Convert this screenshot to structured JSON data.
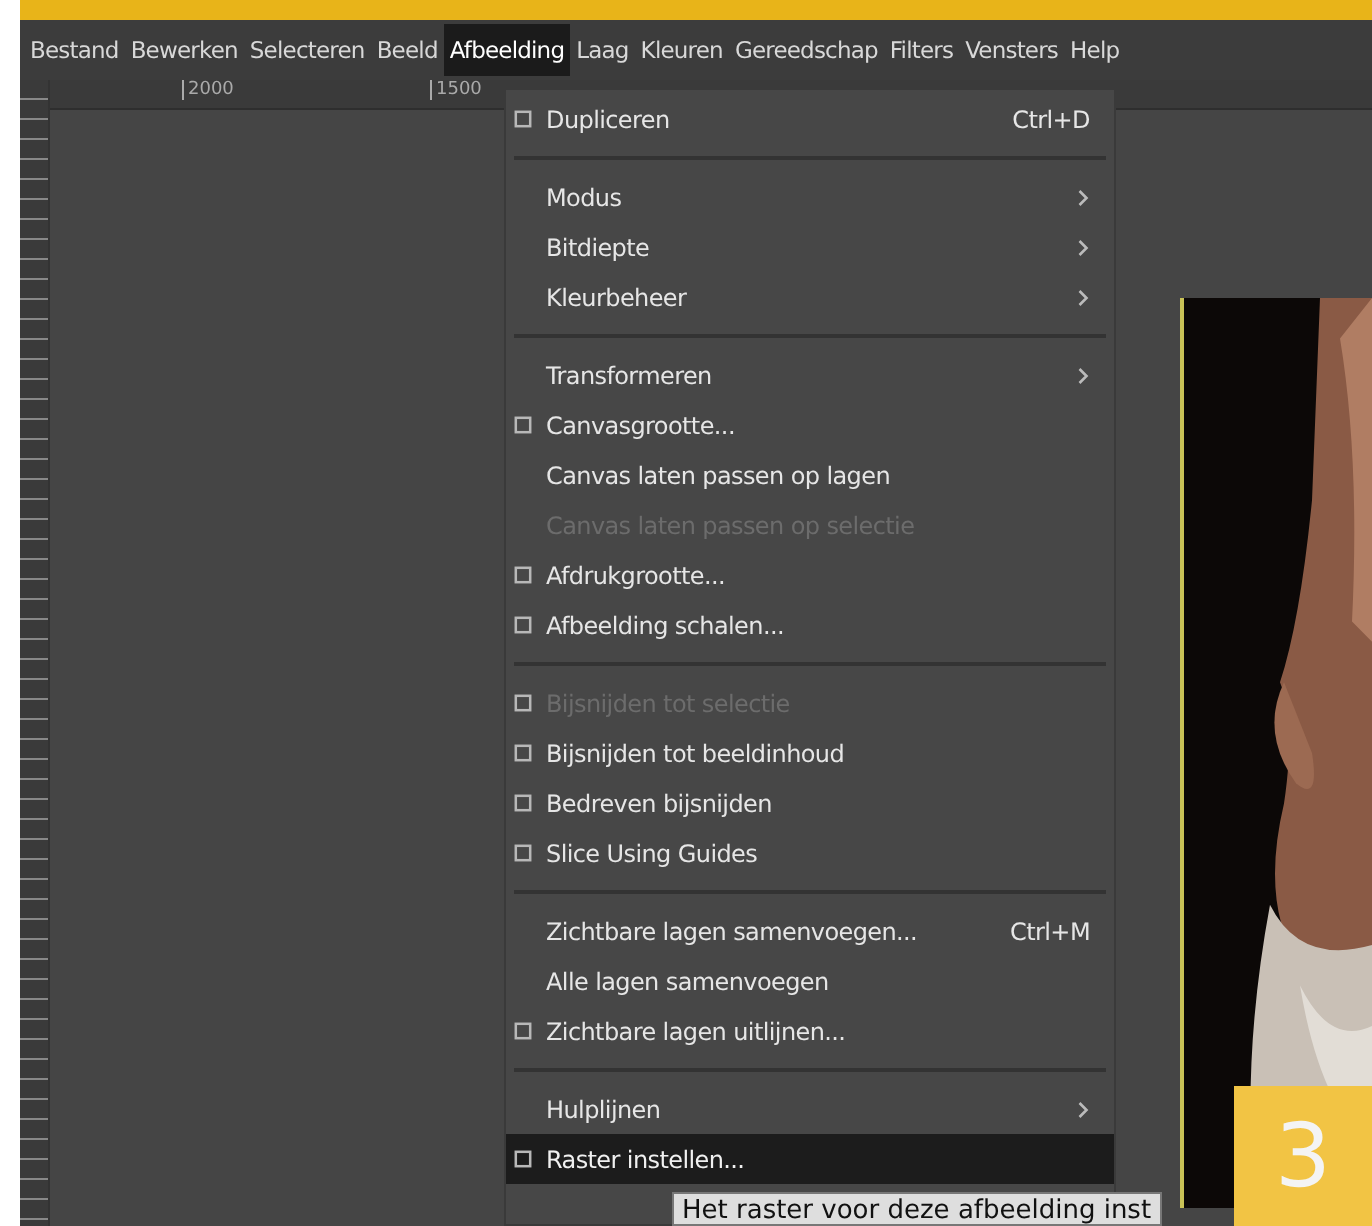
{
  "menubar": [
    {
      "label": "Bestand",
      "selected": false
    },
    {
      "label": "Bewerken",
      "selected": false
    },
    {
      "label": "Selecteren",
      "selected": false
    },
    {
      "label": "Beeld",
      "selected": false
    },
    {
      "label": "Afbeelding",
      "selected": true
    },
    {
      "label": "Laag",
      "selected": false
    },
    {
      "label": "Kleuren",
      "selected": false
    },
    {
      "label": "Gereedschap",
      "selected": false
    },
    {
      "label": "Filters",
      "selected": false
    },
    {
      "label": "Vensters",
      "selected": false
    },
    {
      "label": "Help",
      "selected": false
    }
  ],
  "ruler": {
    "labels": [
      "2000",
      "1500"
    ]
  },
  "menu": [
    {
      "kind": "item",
      "label": "Dupliceren",
      "shortcut": "Ctrl+D",
      "icon": true,
      "submenu": false,
      "disabled": false,
      "selected": false
    },
    {
      "kind": "separator"
    },
    {
      "kind": "item",
      "label": "Modus",
      "icon": false,
      "submenu": true,
      "disabled": false,
      "selected": false
    },
    {
      "kind": "item",
      "label": "Bitdiepte",
      "icon": false,
      "submenu": true,
      "disabled": false,
      "selected": false
    },
    {
      "kind": "item",
      "label": "Kleurbeheer",
      "icon": false,
      "submenu": true,
      "disabled": false,
      "selected": false
    },
    {
      "kind": "separator"
    },
    {
      "kind": "item",
      "label": "Transformeren",
      "icon": false,
      "submenu": true,
      "disabled": false,
      "selected": false
    },
    {
      "kind": "item",
      "label": "Canvasgrootte...",
      "icon": true,
      "submenu": false,
      "disabled": false,
      "selected": false
    },
    {
      "kind": "item",
      "label": "Canvas laten passen op lagen",
      "icon": false,
      "submenu": false,
      "disabled": false,
      "selected": false
    },
    {
      "kind": "item",
      "label": "Canvas laten passen op selectie",
      "icon": false,
      "submenu": false,
      "disabled": true,
      "selected": false
    },
    {
      "kind": "item",
      "label": "Afdrukgrootte...",
      "icon": true,
      "submenu": false,
      "disabled": false,
      "selected": false
    },
    {
      "kind": "item",
      "label": "Afbeelding schalen...",
      "icon": true,
      "submenu": false,
      "disabled": false,
      "selected": false
    },
    {
      "kind": "separator"
    },
    {
      "kind": "item",
      "label": "Bijsnijden tot selectie",
      "icon": true,
      "submenu": false,
      "disabled": true,
      "selected": false
    },
    {
      "kind": "item",
      "label": "Bijsnijden tot beeldinhoud",
      "icon": true,
      "submenu": false,
      "disabled": false,
      "selected": false
    },
    {
      "kind": "item",
      "label": "Bedreven bijsnijden",
      "icon": true,
      "submenu": false,
      "disabled": false,
      "selected": false
    },
    {
      "kind": "item",
      "label": "Slice Using Guides",
      "icon": true,
      "submenu": false,
      "disabled": false,
      "selected": false
    },
    {
      "kind": "separator"
    },
    {
      "kind": "item",
      "label": "Zichtbare lagen samenvoegen...",
      "shortcut": "Ctrl+M",
      "icon": false,
      "submenu": false,
      "disabled": false,
      "selected": false
    },
    {
      "kind": "item",
      "label": "Alle lagen samenvoegen",
      "icon": false,
      "submenu": false,
      "disabled": false,
      "selected": false
    },
    {
      "kind": "item",
      "label": "Zichtbare lagen uitlijnen...",
      "icon": true,
      "submenu": false,
      "disabled": false,
      "selected": false
    },
    {
      "kind": "separator"
    },
    {
      "kind": "item",
      "label": "Hulplijnen",
      "icon": false,
      "submenu": true,
      "disabled": false,
      "selected": false
    },
    {
      "kind": "item",
      "label": "Raster instellen...",
      "icon": true,
      "submenu": false,
      "disabled": false,
      "selected": true
    }
  ],
  "tooltip": "Het raster voor deze afbeelding inst",
  "step_badge": "3"
}
